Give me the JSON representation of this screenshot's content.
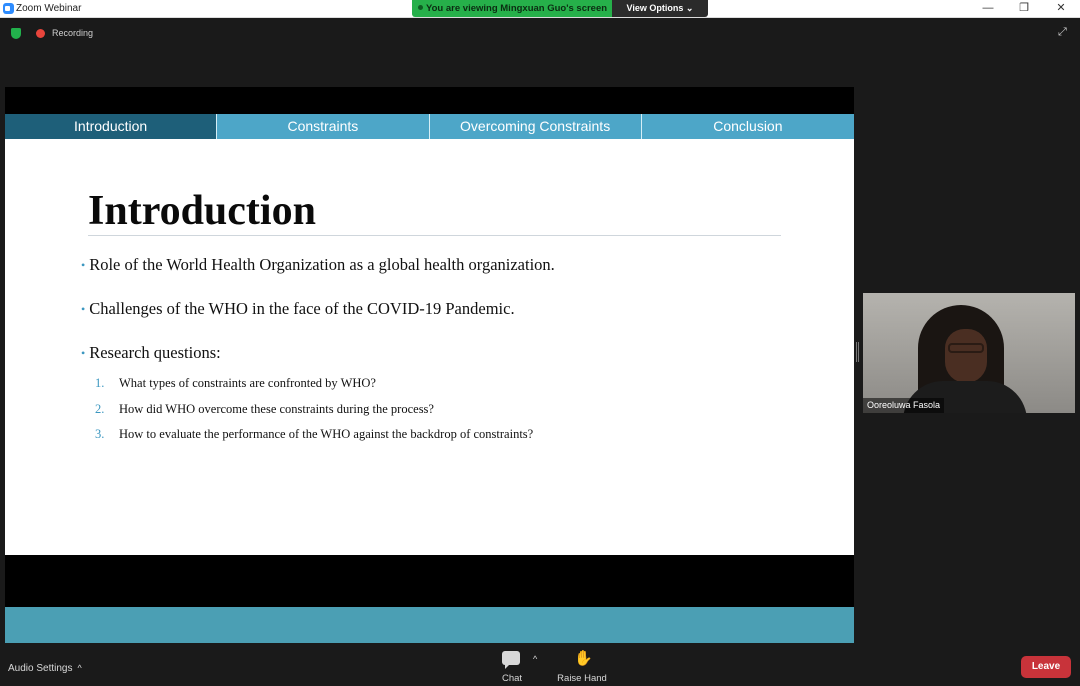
{
  "window": {
    "title": "Zoom Webinar",
    "min_glyph": "—",
    "max_glyph": "❐",
    "close_glyph": "✕"
  },
  "banner": {
    "viewing_text": "You are viewing Mingxuan Guo's screen",
    "view_options_label": "View Options ⌄",
    "accent": "#26b04a"
  },
  "status": {
    "recording_label": "Recording",
    "recording_color": "#e8453c",
    "fullscreen_glyph": "⤢"
  },
  "slide": {
    "tabs": [
      {
        "label": "Introduction",
        "active": true
      },
      {
        "label": "Constraints",
        "active": false
      },
      {
        "label": "Overcoming Constraints",
        "active": false
      },
      {
        "label": "Conclusion",
        "active": false
      }
    ],
    "title": "Introduction",
    "bullets": [
      "Role of the World Health Organization as a global health organization.",
      "Challenges of the WHO in the face of the COVID-19 Pandemic.",
      "Research questions:"
    ],
    "bullet_glyph": "•",
    "research_questions": [
      {
        "num": "1.",
        "text": "What types of constraints are confronted by WHO?"
      },
      {
        "num": "2.",
        "text": "How did WHO overcome these constraints during the process?"
      },
      {
        "num": "3.",
        "text": "How to evaluate the performance of the WHO against the backdrop of constraints?"
      }
    ],
    "tab_color": "#4da6c8",
    "active_tab_color": "#1e5f79",
    "band_color": "#4b9fb4"
  },
  "participant": {
    "name": "Ooreoluwa Fasola"
  },
  "toolbar": {
    "audio_settings_label": "Audio Settings",
    "caret_glyph": "^",
    "chat_label": "Chat",
    "raise_hand_label": "Raise Hand",
    "raise_hand_glyph": "✋",
    "leave_label": "Leave",
    "leave_color": "#c8333a"
  }
}
